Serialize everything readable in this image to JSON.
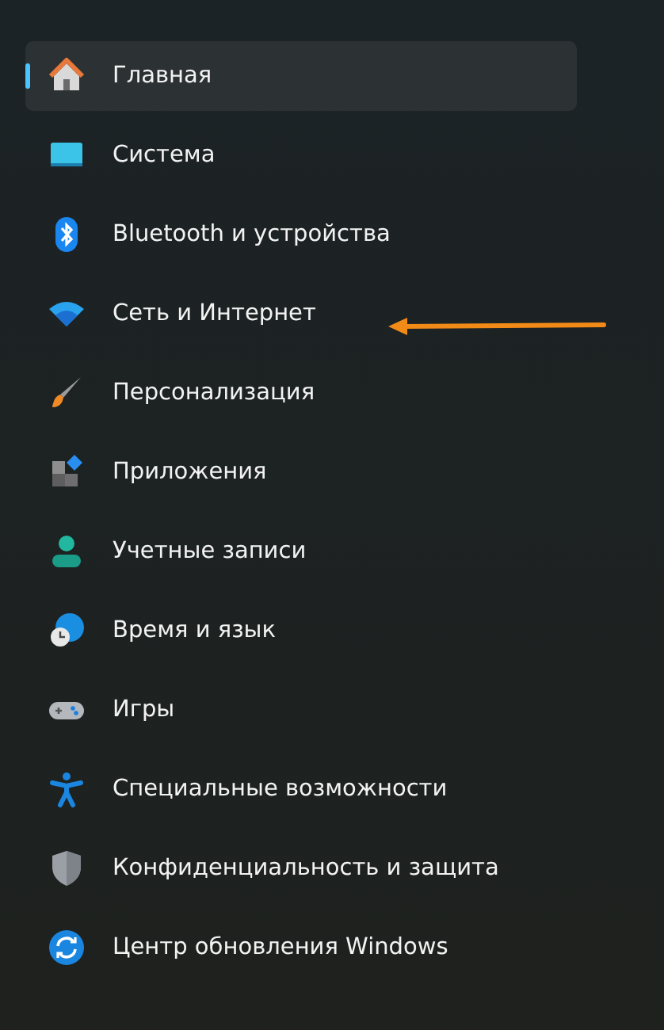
{
  "sidebar": {
    "items": [
      {
        "label": "Главная",
        "kind": "home",
        "selected": true
      },
      {
        "label": "Система",
        "kind": "system",
        "selected": false
      },
      {
        "label": "Bluetooth и устройства",
        "kind": "bluetooth",
        "selected": false
      },
      {
        "label": "Сеть и Интернет",
        "kind": "network",
        "selected": false
      },
      {
        "label": "Персонализация",
        "kind": "brush",
        "selected": false
      },
      {
        "label": "Приложения",
        "kind": "apps",
        "selected": false
      },
      {
        "label": "Учетные записи",
        "kind": "account",
        "selected": false
      },
      {
        "label": "Время и язык",
        "kind": "time",
        "selected": false
      },
      {
        "label": "Игры",
        "kind": "games",
        "selected": false
      },
      {
        "label": "Специальные возможности",
        "kind": "accessibility",
        "selected": false
      },
      {
        "label": "Конфиденциальность и защита",
        "kind": "privacy",
        "selected": false
      },
      {
        "label": "Центр обновления Windows",
        "kind": "update",
        "selected": false
      }
    ]
  }
}
